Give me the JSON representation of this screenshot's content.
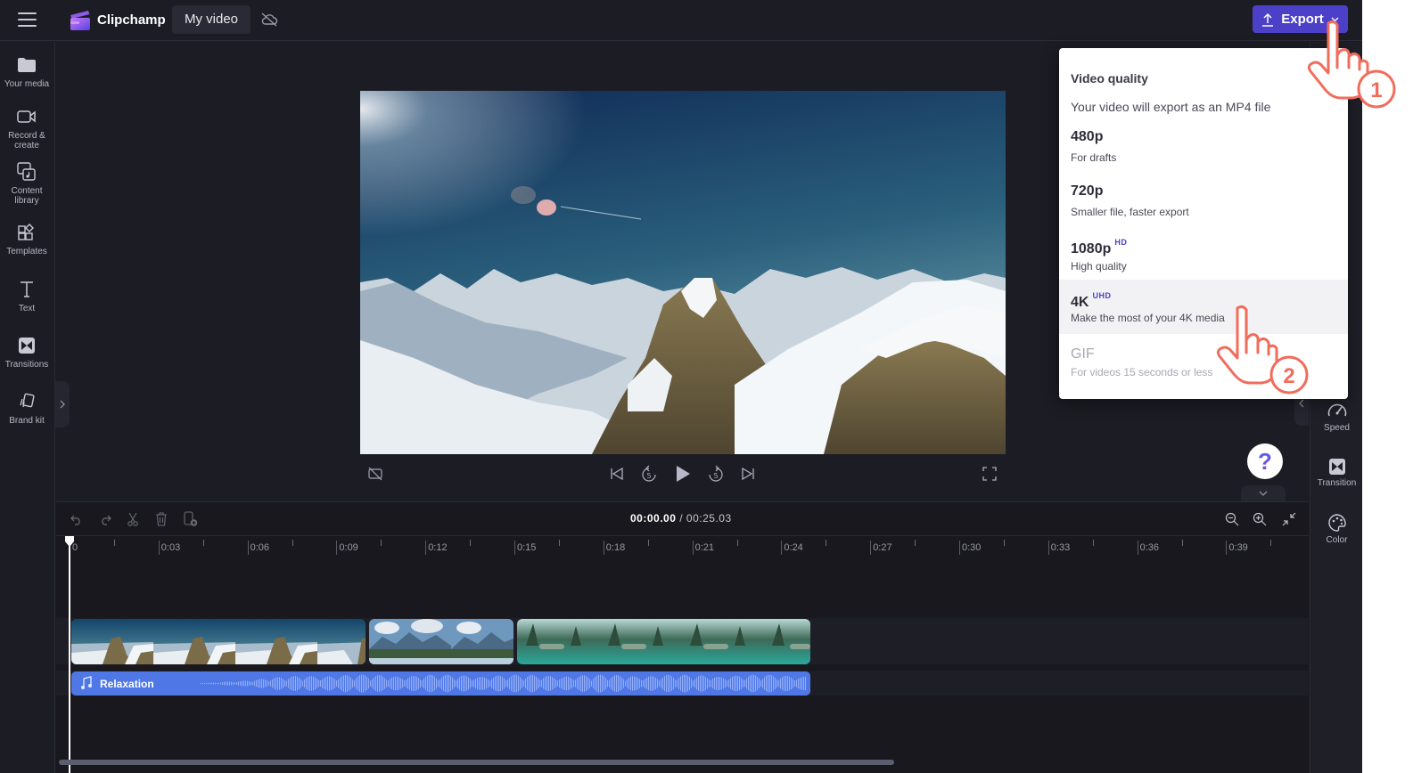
{
  "app": {
    "brand": "Clipchamp",
    "project_title": "My video",
    "sync_status_icon": "cloud-off-icon",
    "accent_color": "#4d40c8"
  },
  "header": {
    "export_label": "Export"
  },
  "left_sidebar": {
    "items": [
      {
        "label": "Your media",
        "icon": "folder-icon"
      },
      {
        "label": "Record & create",
        "icon": "camera-icon"
      },
      {
        "label": "Content library",
        "icon": "content-library-icon"
      },
      {
        "label": "Templates",
        "icon": "templates-icon"
      },
      {
        "label": "Text",
        "icon": "text-icon"
      },
      {
        "label": "Transitions",
        "icon": "transitions-icon"
      },
      {
        "label": "Brand kit",
        "icon": "brand-kit-icon"
      }
    ]
  },
  "right_sidebar": {
    "items": [
      {
        "label": "Speed",
        "icon": "speed-icon"
      },
      {
        "label": "Transition",
        "icon": "transition-icon"
      },
      {
        "label": "Color",
        "icon": "color-palette-icon"
      }
    ]
  },
  "export_menu": {
    "title": "Video quality",
    "description": "Your video will export as an MP4 file",
    "options": [
      {
        "name": "480p",
        "badge": "",
        "subtitle": "For drafts",
        "state": "normal"
      },
      {
        "name": "720p",
        "badge": "",
        "subtitle": "Smaller file, faster export",
        "state": "normal"
      },
      {
        "name": "1080p",
        "badge": "HD",
        "subtitle": "High quality",
        "state": "normal"
      },
      {
        "name": "4K",
        "badge": "UHD",
        "subtitle": "Make the most of your 4K media",
        "state": "hovered"
      },
      {
        "name": "GIF",
        "badge": "",
        "subtitle": "For videos 15 seconds or less",
        "state": "disabled"
      }
    ]
  },
  "annotations": [
    {
      "step": "1",
      "target": "export-button"
    },
    {
      "step": "2",
      "target": "export-option-4k"
    }
  ],
  "player": {
    "help_label": "?"
  },
  "timeline": {
    "current_time": "00:00.00",
    "separator": "/",
    "total_time": "00:25.03",
    "ruler_labels": [
      "0",
      "0:03",
      "0:06",
      "0:09",
      "0:12",
      "0:15",
      "0:18",
      "0:21",
      "0:24",
      "0:27",
      "0:30",
      "0:33",
      "0:36",
      "0:39"
    ],
    "video_clips": [
      {
        "name": "Snowy mountain peak",
        "thumbnails": 4
      },
      {
        "name": "Mountain lake forest",
        "thumbnails": 2
      },
      {
        "name": "Turquoise lake",
        "thumbnails": 4
      }
    ],
    "audio_clip": {
      "label": "Relaxation",
      "color": "#4f78e6"
    }
  }
}
